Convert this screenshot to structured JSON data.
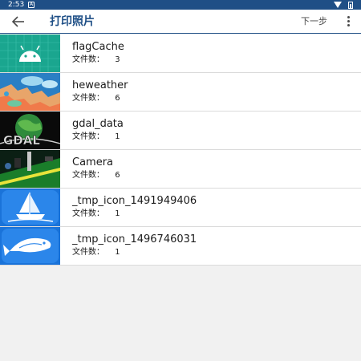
{
  "status_bar": {
    "time": "2:53",
    "notification_icon": "A"
  },
  "toolbar": {
    "title": "打印照片",
    "next_label": "下一步"
  },
  "folder_list": {
    "count_label": "文件数：",
    "items": [
      {
        "name": "flagCache",
        "count": "3",
        "thumbnail": "android-icon"
      },
      {
        "name": "heweather",
        "count": "6",
        "thumbnail": "weather-map-image"
      },
      {
        "name": "gdal_data",
        "count": "1",
        "thumbnail": "gdal-globe-logo"
      },
      {
        "name": "Camera",
        "count": "6",
        "thumbnail": "camera-photo"
      },
      {
        "name": "_tmp_icon_1491949406",
        "count": "1",
        "thumbnail": "junk-boat-icon"
      },
      {
        "name": "_tmp_icon_1496746031",
        "count": "1",
        "thumbnail": "fish-icon"
      }
    ]
  },
  "colors": {
    "brand": "#1f4f86",
    "icon_blue": "#1a73d9",
    "android_green": "#1aa68f"
  }
}
